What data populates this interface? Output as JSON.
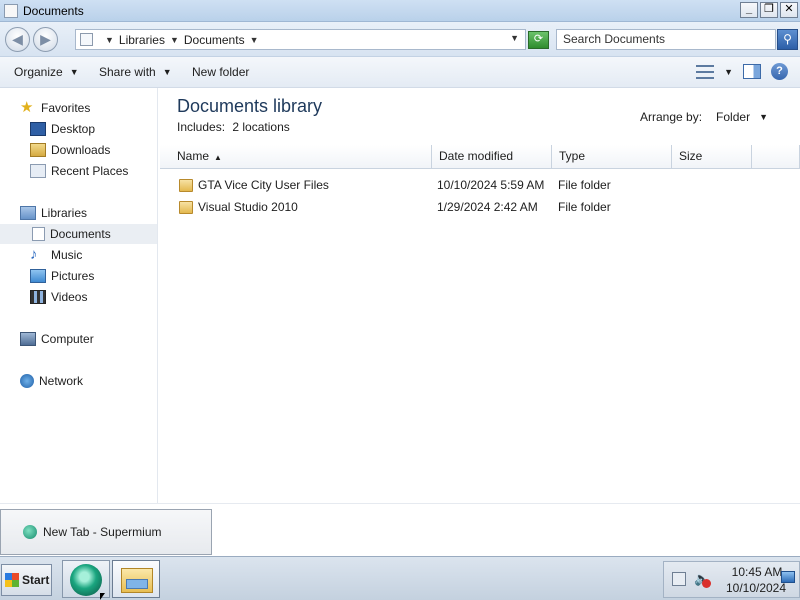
{
  "window": {
    "title": "Documents"
  },
  "title_buttons": {
    "minimize": "_",
    "maximize": "❐",
    "close": "✕"
  },
  "address": {
    "crumbs": [
      "Libraries",
      "Documents"
    ],
    "refresh_icon": "⟳"
  },
  "search": {
    "placeholder": "Search Documents",
    "button_icon": "⚲"
  },
  "commands": {
    "organize": "Organize",
    "share_with": "Share with",
    "new_folder": "New folder",
    "help": "?"
  },
  "nav": {
    "favorites": "Favorites",
    "desktop": "Desktop",
    "downloads": "Downloads",
    "recent_places": "Recent Places",
    "libraries": "Libraries",
    "documents": "Documents",
    "music": "Music",
    "pictures": "Pictures",
    "videos": "Videos",
    "computer": "Computer",
    "network": "Network"
  },
  "library": {
    "title": "Documents library",
    "includes_label": "Includes:",
    "includes_value": "2 locations",
    "arrange_label": "Arrange by:",
    "arrange_value": "Folder"
  },
  "columns": {
    "name": "Name",
    "date_modified": "Date modified",
    "type": "Type",
    "size": "Size"
  },
  "files": [
    {
      "name": "GTA Vice City User Files",
      "date": "10/10/2024 5:59 AM",
      "type": "File folder",
      "size": ""
    },
    {
      "name": "Visual Studio 2010",
      "date": "1/29/2024 2:42 AM",
      "type": "File folder",
      "size": ""
    }
  ],
  "taskbar_popup": {
    "label": "New Tab - Supermium"
  },
  "taskbar": {
    "start_label": "Start"
  },
  "clock": {
    "time": "10:45 AM",
    "date": "10/10/2024"
  },
  "icons": {
    "back": "back-arrow-icon",
    "forward": "forward-arrow-icon",
    "favorites": "star-icon",
    "folder": "folder-icon",
    "browser": "supermium-icon",
    "explorer": "explorer-icon"
  },
  "colors": {
    "title_text": "#1e395b",
    "selected_row": "#eaeef3",
    "titlebar": "#c3d8ef"
  }
}
